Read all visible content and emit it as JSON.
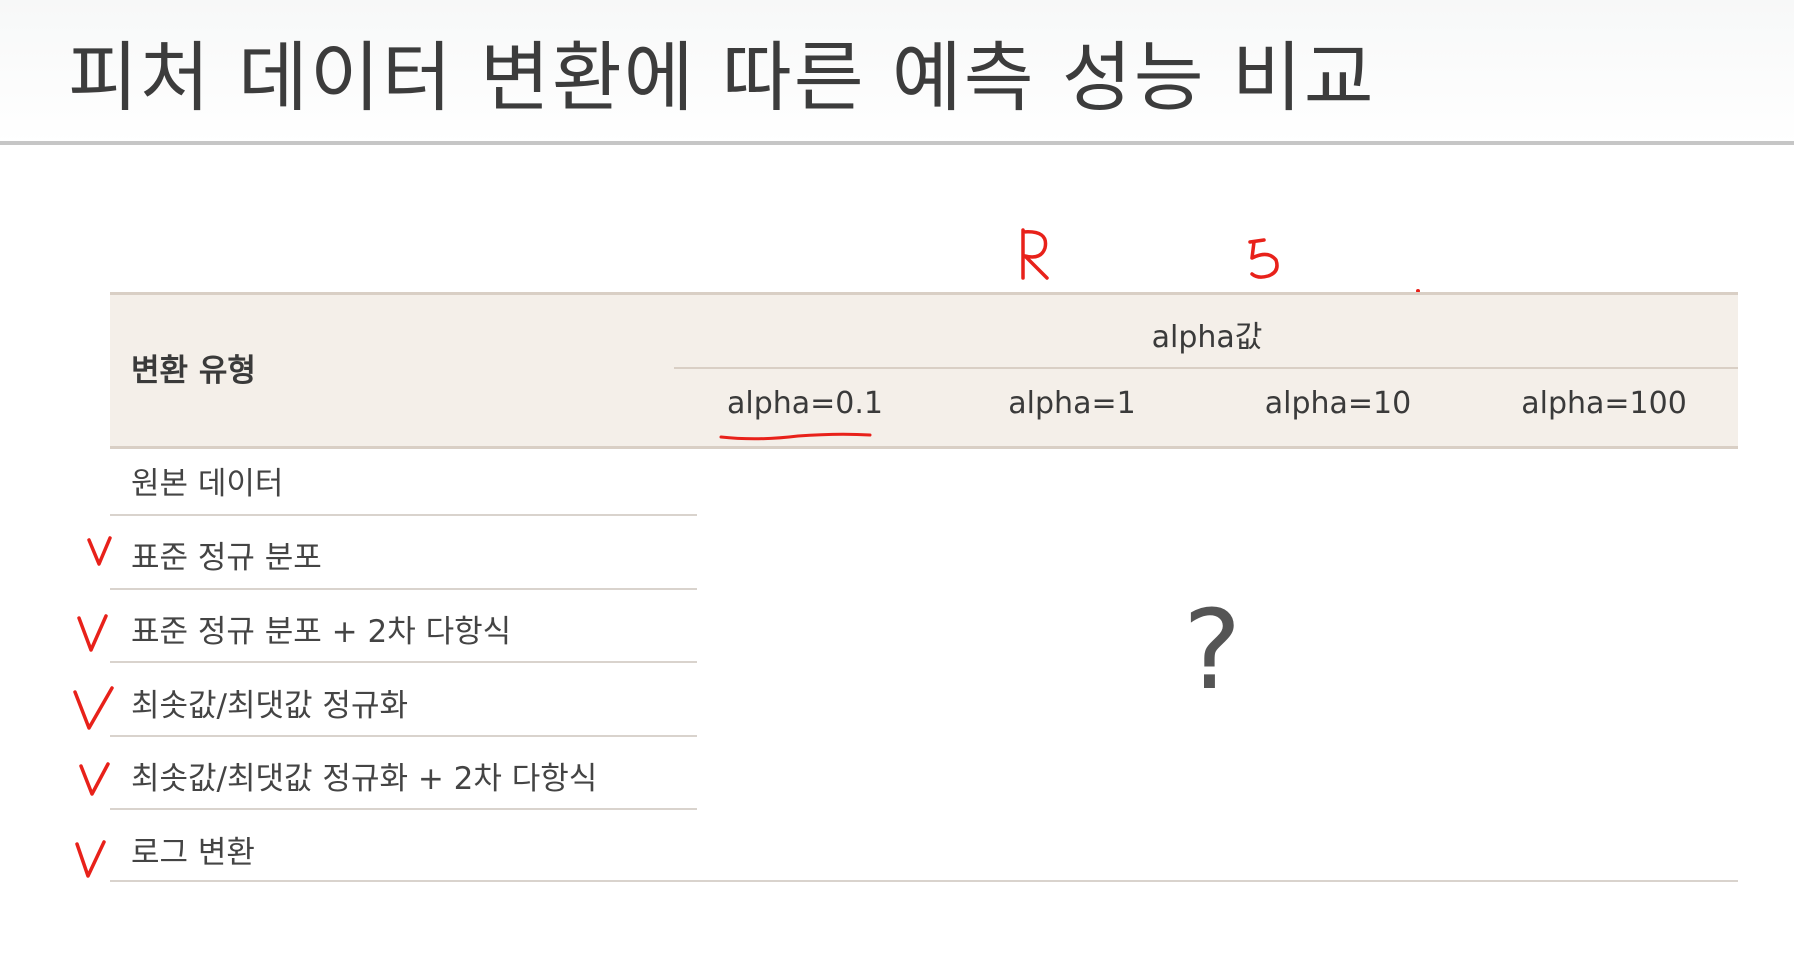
{
  "title": "피처 데이터 변환에 따른 예측 성능 비교",
  "annotations": {
    "r_mark": "R",
    "s_mark": "5",
    "question": "?",
    "ink_color": "#e8211a"
  },
  "table": {
    "header_type": "변환 유형",
    "header_alpha": "alpha값",
    "alpha_columns": [
      "alpha=0.1",
      "alpha=1",
      "alpha=10",
      "alpha=100"
    ],
    "rows": [
      {
        "label": "원본 데이터",
        "checked": false
      },
      {
        "label": "표준 정규 분포",
        "checked": true
      },
      {
        "label": "표준 정규 분포 + 2차 다항식",
        "checked": true
      },
      {
        "label": "최솟값/최댓값 정규화",
        "checked": true
      },
      {
        "label": "최솟값/최댓값 정규화 + 2차 다항식",
        "checked": true
      },
      {
        "label": "로그 변환",
        "checked": true
      }
    ]
  }
}
